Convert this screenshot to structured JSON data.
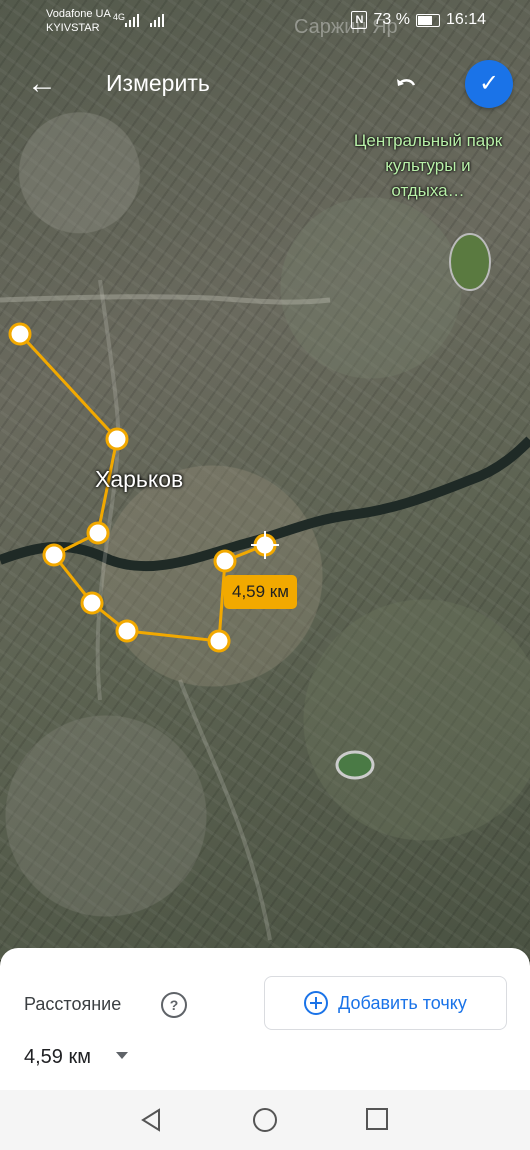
{
  "statusbar": {
    "carrier_1": "Vodafone UA",
    "carrier_2": "KYIVSTAR",
    "network": "4G",
    "nfc": "N",
    "battery": "73 %",
    "time": "16:14"
  },
  "topbar": {
    "title": "Измерить",
    "back_icon": "arrow-left-icon",
    "undo_icon": "undo-icon",
    "confirm_icon": "check-icon"
  },
  "map": {
    "city_label": "Харьков",
    "park_label": "Центральный парк культуры и отдыха…",
    "faint_label": "Саржин Яр",
    "distance_chip": "4,59 км",
    "route_color": "#f2a900"
  },
  "sheet": {
    "distance_label": "Расстояние",
    "distance_value": "4,59 км",
    "add_point_label": "Добавить точку",
    "accent": "#1a73e8"
  }
}
